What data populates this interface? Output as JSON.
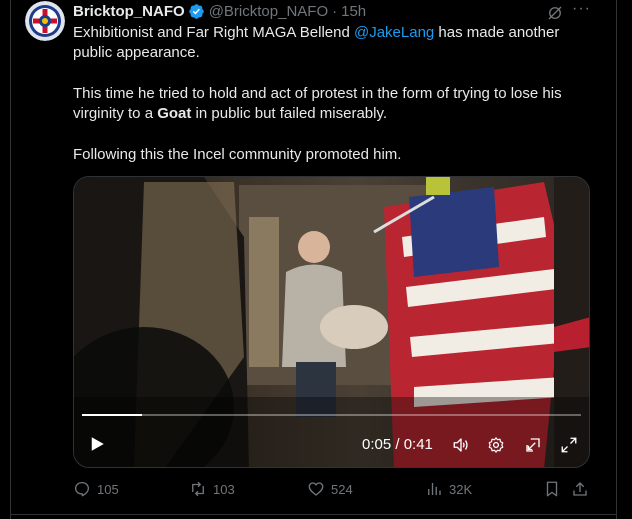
{
  "tweet": {
    "author_name": "Bricktop_NAFO",
    "author_handle": "@Bricktop_NAFO",
    "separator": "·",
    "time": "15h",
    "text_p1_a": "Exhibitionist and Far Right MAGA Bellend ",
    "mention": "@JakeLang",
    "text_p1_b": " has made another public appearance.",
    "text_p2_a": "This time he tried to hold and act of protest in the form of trying to lose his virginity to a ",
    "text_p2_bold": "Goat",
    "text_p2_b": " in public but failed miserably.",
    "text_p3": "Following this the Incel community promoted him."
  },
  "video": {
    "timecode": "0:05 / 0:41",
    "progress": 0.12
  },
  "actions": {
    "replies": "105",
    "reposts": "103",
    "likes": "524",
    "views": "32K"
  },
  "icons": {
    "verified": "verified-badge-icon",
    "grok": "grok-icon",
    "more": "more-icon",
    "play": "play-icon",
    "volume": "volume-icon",
    "settings": "settings-icon",
    "pip": "picture-in-picture-icon",
    "fullscreen": "fullscreen-icon",
    "reply": "reply-icon",
    "repost": "repost-icon",
    "like": "like-icon",
    "views": "views-icon",
    "bookmark": "bookmark-icon",
    "share": "share-icon"
  },
  "colors": {
    "background": "#000000",
    "text": "#e7e9ea",
    "muted": "#71767b",
    "link": "#1d9bf0",
    "border": "#2f3336"
  }
}
